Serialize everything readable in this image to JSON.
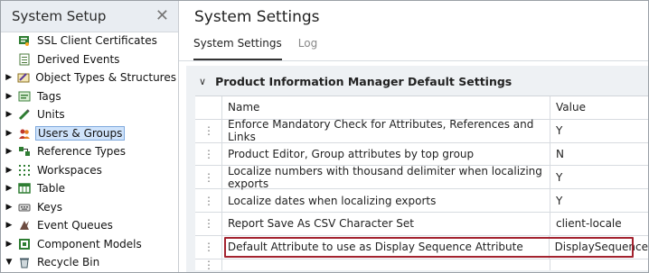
{
  "left_panel": {
    "title": "System Setup",
    "close_glyph": "✕",
    "tree": [
      {
        "label": "SSL Client Certificates",
        "caret": "",
        "icon": "ssl-cert-icon"
      },
      {
        "label": "Derived Events",
        "caret": "",
        "icon": "derived-events-icon"
      },
      {
        "label": "Object Types & Structures",
        "caret": "▶",
        "icon": "object-types-icon"
      },
      {
        "label": "Tags",
        "caret": "▶",
        "icon": "tags-icon"
      },
      {
        "label": "Units",
        "caret": "▶",
        "icon": "units-icon"
      },
      {
        "label": "Users & Groups",
        "caret": "▶",
        "icon": "users-groups-icon",
        "selected": true
      },
      {
        "label": "Reference Types",
        "caret": "▶",
        "icon": "reference-types-icon"
      },
      {
        "label": "Workspaces",
        "caret": "▶",
        "icon": "workspaces-icon"
      },
      {
        "label": "Table",
        "caret": "▶",
        "icon": "table-icon"
      },
      {
        "label": "Keys",
        "caret": "▶",
        "icon": "keys-icon"
      },
      {
        "label": "Event Queues",
        "caret": "▶",
        "icon": "event-queues-icon"
      },
      {
        "label": "Component Models",
        "caret": "▶",
        "icon": "component-models-icon"
      },
      {
        "label": "Recycle Bin",
        "caret": "▼",
        "icon": "recycle-bin-icon"
      }
    ]
  },
  "main": {
    "title": "System Settings",
    "tabs": [
      {
        "label": "System Settings",
        "active": true
      },
      {
        "label": "Log",
        "active": false
      }
    ],
    "section": {
      "chevron": "∨",
      "title": "Product Information Manager Default Settings"
    },
    "table": {
      "columns": {
        "name": "Name",
        "value": "Value"
      },
      "handle_glyph": "⋮",
      "rows": [
        {
          "name": "Enforce Mandatory Check for Attributes, References and Links",
          "value": "Y"
        },
        {
          "name": "Product Editor, Group attributes by top group",
          "value": "N"
        },
        {
          "name": "Localize numbers with thousand delimiter when localizing exports",
          "value": "Y"
        },
        {
          "name": "Localize dates when localizing exports",
          "value": "Y"
        },
        {
          "name": "Report Save As CSV Character Set",
          "value": "client-locale"
        },
        {
          "name": "Default Attribute to use as Display Sequence Attribute",
          "value": "DisplaySequence",
          "highlighted": true
        }
      ]
    }
  },
  "colors": {
    "selection_bg": "#cfe3fb",
    "highlight_border": "#a3232f",
    "panel_header_bg": "#e9edf2",
    "content_bg": "#eef1f4"
  }
}
